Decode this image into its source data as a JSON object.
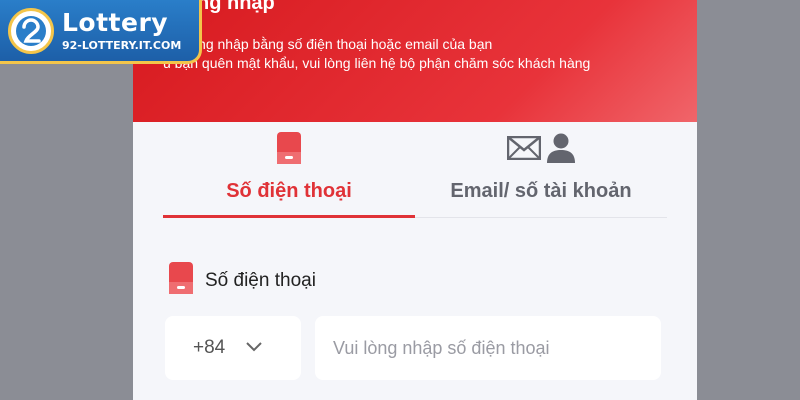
{
  "logo": {
    "title": "Lottery",
    "url": "92-LOTTERY.IT.COM"
  },
  "hero": {
    "title": "ng nhập",
    "subtitle_line1": "ng đăng nhập bằng số điện thoại hoặc email của bạn",
    "subtitle_line2": "u bạn quên mật khẩu, vui lòng liên hệ bộ phận chăm sóc khách hàng"
  },
  "tabs": [
    {
      "label": "Số điện thoại",
      "icon": "phone-icon",
      "active": true
    },
    {
      "label": "Email/ số tài khoản",
      "icon": "mail-user-icon",
      "active": false
    }
  ],
  "form": {
    "field_label": "Số điện thoại",
    "country_code": "+84",
    "phone_placeholder": "Vui lòng nhập số điện thoại"
  },
  "colors": {
    "accent": "#e03237",
    "hero_red": "#d71a1f",
    "background": "#8b8d95",
    "inactive_text": "#63656e",
    "logo_blue": "#1d5fa8",
    "logo_gold": "#f3c54a"
  }
}
